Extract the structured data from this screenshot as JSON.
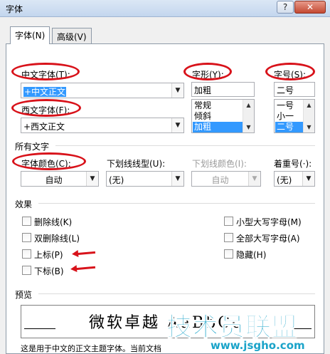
{
  "window": {
    "title": "字体",
    "help_label": "?",
    "close_label": "✕"
  },
  "tabs": [
    {
      "label": "字体(N)",
      "active": true
    },
    {
      "label": "高级(V)",
      "active": false
    }
  ],
  "font": {
    "chinese_label": "中文字体(T):",
    "chinese_value": "+中文正文",
    "western_label": "西文字体(F):",
    "western_value": "+西文正文"
  },
  "style": {
    "label": "字形(Y):",
    "value": "加粗",
    "options": [
      "常规",
      "倾斜",
      "加粗"
    ],
    "selected_index": 2
  },
  "size": {
    "label": "字号(S):",
    "value": "二号",
    "options": [
      "一号",
      "小一",
      "二号"
    ],
    "selected_index": 2
  },
  "all_text": {
    "section_label": "所有文字",
    "font_color_label": "字体颜色(C):",
    "font_color_value": "自动",
    "underline_style_label": "下划线线型(U):",
    "underline_style_value": "(无)",
    "underline_color_label": "下划线颜色(I):",
    "underline_color_value": "自动",
    "emphasis_label": "着重号(·):",
    "emphasis_value": "(无)"
  },
  "effects": {
    "section_label": "效果",
    "left": [
      "删除线(K)",
      "双删除线(L)",
      "上标(P)",
      "下标(B)"
    ],
    "right": [
      "小型大写字母(M)",
      "全部大写字母(A)",
      "隐藏(H)"
    ]
  },
  "preview": {
    "section_label": "预览",
    "sample_text": "微软卓越 AaBbCc",
    "description": "这是用于中文的正文主题字体。当前文档"
  },
  "watermark": {
    "text": "技术员联盟",
    "url": "www.jsgho.com"
  },
  "colors": {
    "annotation_red": "#d8121a",
    "selection_blue": "#3399ff",
    "watermark_blue": "#1aa3c9"
  }
}
